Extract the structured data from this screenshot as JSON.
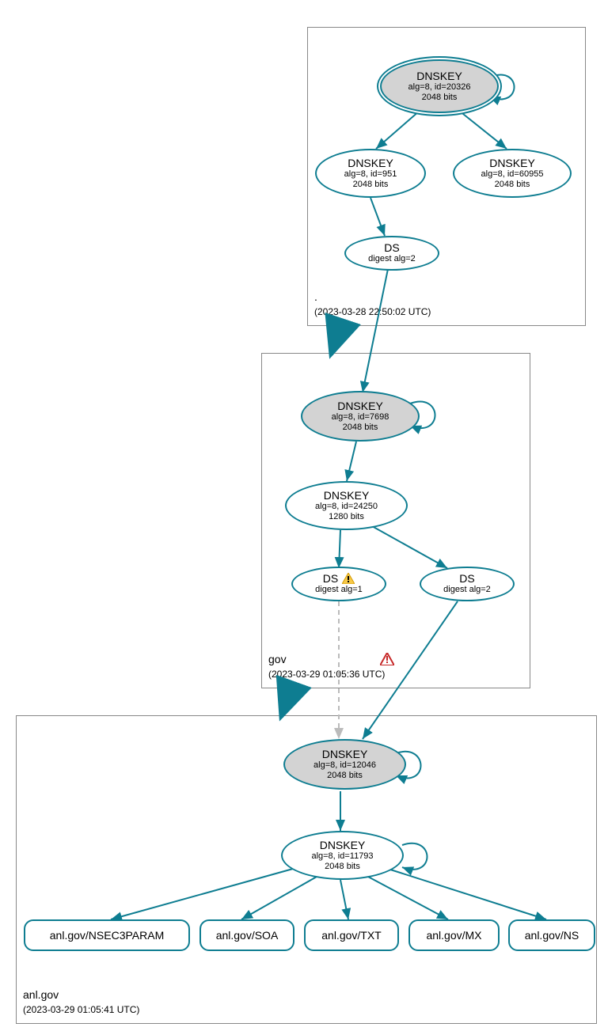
{
  "zones": {
    "root": {
      "name": ".",
      "timestamp": "(2023-03-28 22:50:02 UTC)"
    },
    "gov": {
      "name": "gov",
      "timestamp": "(2023-03-29 01:05:36 UTC)"
    },
    "anl": {
      "name": "anl.gov",
      "timestamp": "(2023-03-29 01:05:41 UTC)"
    }
  },
  "nodes": {
    "root_ksk": {
      "title": "DNSKEY",
      "line1": "alg=8, id=20326",
      "line2": "2048 bits"
    },
    "root_zsk1": {
      "title": "DNSKEY",
      "line1": "alg=8, id=951",
      "line2": "2048 bits"
    },
    "root_zsk2": {
      "title": "DNSKEY",
      "line1": "alg=8, id=60955",
      "line2": "2048 bits"
    },
    "root_ds": {
      "title": "DS",
      "line1": "digest alg=2"
    },
    "gov_ksk": {
      "title": "DNSKEY",
      "line1": "alg=8, id=7698",
      "line2": "2048 bits"
    },
    "gov_zsk": {
      "title": "DNSKEY",
      "line1": "alg=8, id=24250",
      "line2": "1280 bits"
    },
    "gov_ds1": {
      "title": "DS",
      "line1": "digest alg=1"
    },
    "gov_ds2": {
      "title": "DS",
      "line1": "digest alg=2"
    },
    "anl_ksk": {
      "title": "DNSKEY",
      "line1": "alg=8, id=12046",
      "line2": "2048 bits"
    },
    "anl_zsk": {
      "title": "DNSKEY",
      "line1": "alg=8, id=11793",
      "line2": "2048 bits"
    },
    "rec_nsec3": {
      "title": "anl.gov/NSEC3PARAM"
    },
    "rec_soa": {
      "title": "anl.gov/SOA"
    },
    "rec_txt": {
      "title": "anl.gov/TXT"
    },
    "rec_mx": {
      "title": "anl.gov/MX"
    },
    "rec_ns": {
      "title": "anl.gov/NS"
    }
  }
}
